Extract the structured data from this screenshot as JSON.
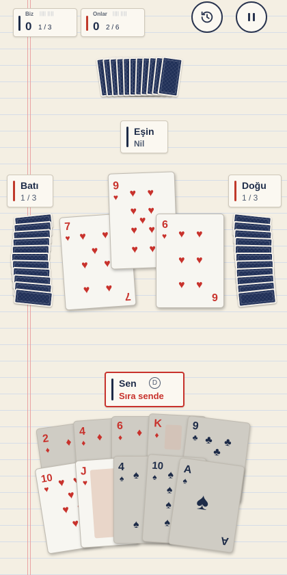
{
  "scoreboard": {
    "us": {
      "label": "Biz",
      "points": "0",
      "tricks": "1 / 3",
      "ticks": "||||  ||||"
    },
    "them": {
      "label": "Onlar",
      "points": "0",
      "tricks": "2 / 6",
      "ticks": "||||  ||||"
    }
  },
  "buttons": {
    "history_icon": "history-icon",
    "pause_icon": "pause-icon"
  },
  "players": {
    "partner": {
      "name": "Eşin",
      "status": "Nil"
    },
    "west": {
      "name": "Batı",
      "status": "1 / 3"
    },
    "east": {
      "name": "Doğu",
      "status": "1 / 3"
    },
    "me": {
      "name": "Sen",
      "dealer_badge": "D",
      "status": "Sıra sende"
    }
  },
  "trick_cards": [
    {
      "seat": "west",
      "rank": "7",
      "suit": "♥"
    },
    {
      "seat": "north",
      "rank": "9",
      "suit": "♥"
    },
    {
      "seat": "east",
      "rank": "6",
      "suit": "♥"
    }
  ],
  "hand": {
    "back_row": [
      {
        "rank": "2",
        "suit": "♦"
      },
      {
        "rank": "4",
        "suit": "♦"
      },
      {
        "rank": "6",
        "suit": "♦"
      },
      {
        "rank": "K",
        "suit": "♦"
      },
      {
        "rank": "9",
        "suit": "♣"
      }
    ],
    "front_row": [
      {
        "rank": "10",
        "suit": "♥"
      },
      {
        "rank": "J",
        "suit": "♥"
      },
      {
        "rank": "4",
        "suit": "♠"
      },
      {
        "rank": "10",
        "suit": "♠"
      },
      {
        "rank": "A",
        "suit": "♠"
      }
    ]
  },
  "colors": {
    "navy": "#1d2b48",
    "red": "#c8322c",
    "card_back": "#1f2f57",
    "paper": "#f4efe3"
  }
}
